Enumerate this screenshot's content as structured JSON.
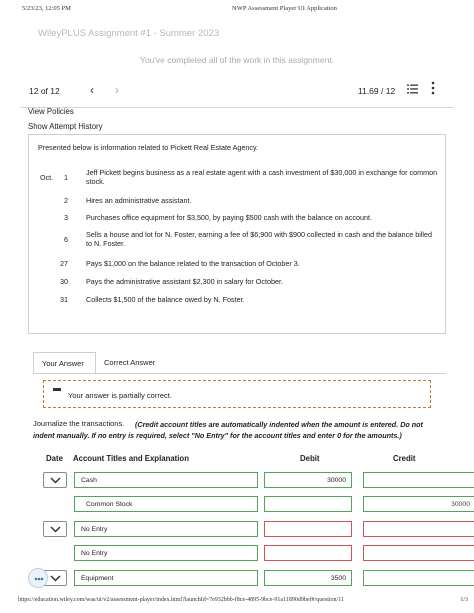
{
  "print_header": {
    "date": "5/23/23, 12:05 PM",
    "title": "NWP Assessment Player UI Application"
  },
  "assignment_title": "WileyPLUS Assignment #1 - Summer 2023",
  "completed_message": "You've completed all of the work in this assignment.",
  "nav": {
    "question_count": "12 of 12",
    "prev_icon": "chevron-left-icon",
    "next_icon": "chevron-right-icon",
    "score": "11.69 / 12",
    "list_icon": "question-list-icon",
    "more_icon": "more-vertical-icon"
  },
  "links": {
    "view_policies": "View Policies",
    "show_attempt_history": "Show Attempt History"
  },
  "problem": {
    "intro": "Presented below is information related to Pickett Real Estate Agency.",
    "month": "Oct.",
    "transactions": [
      {
        "day": "1",
        "text": "Jeff Pickett begins business as a real estate agent with a cash investment of $30,000 in exchange for common stock."
      },
      {
        "day": "2",
        "text": "Hires an administrative assistant."
      },
      {
        "day": "3",
        "text": "Purchases office equipment for $3,500, by paying $500 cash with the balance on account."
      },
      {
        "day": "6",
        "text": "Sells a house and lot for N. Foster, earning a fee of $6,900 with $900 collected in cash and the balance billed to N. Foster."
      },
      {
        "day": "27",
        "text": "Pays $1,000 on the balance related to the transaction of October 3."
      },
      {
        "day": "30",
        "text": "Pays the administrative assistant $2,300 in salary for October."
      },
      {
        "day": "31",
        "text": "Collects $1,500 of the balance owed by N. Foster."
      }
    ]
  },
  "tabs": {
    "your_answer": "Your Answer",
    "correct_answer": "Correct Answer"
  },
  "feedback": {
    "text": "Your answer is partially correct.",
    "accent": "#c9742a"
  },
  "instructions": {
    "label": "Journalize the transactions.",
    "text": "(Credit account titles are automatically indented when the amount is entered. Do not indent manually. If no entry is required, select \"No Entry\" for the account titles and enter 0 for the amounts.)"
  },
  "table": {
    "headers": {
      "date": "Date",
      "account": "Account Titles and Explanation",
      "debit": "Debit",
      "credit": "Credit"
    },
    "rows": [
      {
        "account": "Cash",
        "debit": "30000",
        "credit": ""
      },
      {
        "account": "Common Stock",
        "debit": "",
        "credit": "30000"
      },
      {
        "account": "No Entry",
        "debit": "",
        "credit": ""
      },
      {
        "account": "No Entry",
        "debit": "",
        "credit": ""
      },
      {
        "account": "Equipment",
        "debit": "3500",
        "credit": ""
      }
    ],
    "status_colors": {
      "correct": "#56a35a",
      "incorrect": "#d0555a"
    }
  },
  "print_footer": {
    "url": "https://education.wiley.com/was/ui/v2/assessment-player/index.html?launchId=7e932bbb-f8ce-4895-9bce-91a11890d9bef#/question/11",
    "page": "1/3"
  }
}
